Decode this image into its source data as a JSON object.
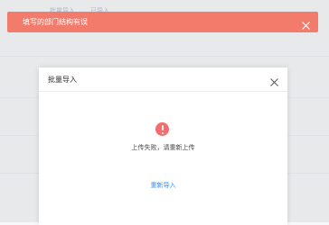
{
  "background": {
    "tabs": [
      "批量导入",
      "已导入"
    ]
  },
  "toast": {
    "message": "填写的部门结构有误",
    "color": "#f37b6b",
    "close_icon": "close-icon"
  },
  "modal": {
    "title": "批量导入",
    "close_icon": "close-icon",
    "status_icon": "error-icon",
    "status_color": "#f56c6c",
    "message": "上传失败，请重新上传",
    "action_label": "重新导入",
    "action_color": "#2d8cf0"
  }
}
